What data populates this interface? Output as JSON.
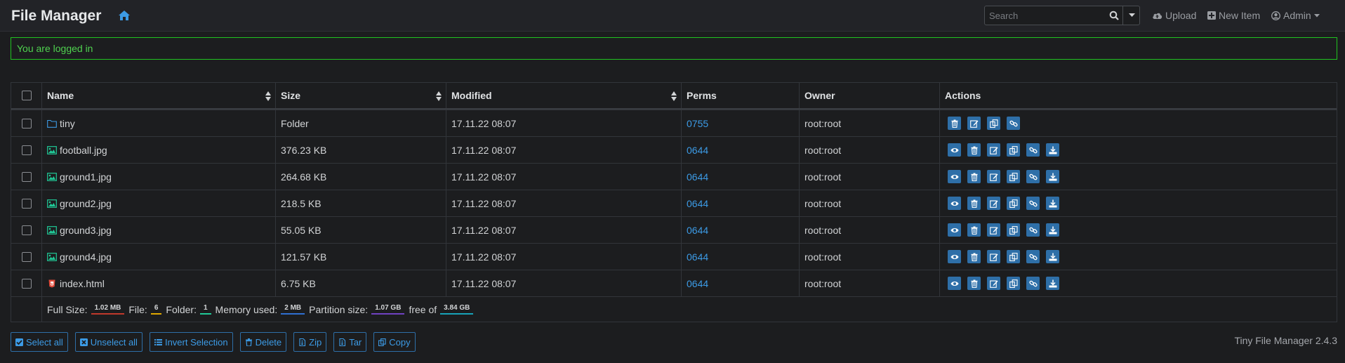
{
  "header": {
    "brand": "File Manager",
    "search_placeholder": "Search",
    "upload_label": "Upload",
    "new_item_label": "New Item",
    "admin_label": "Admin"
  },
  "alert": {
    "message": "You are logged in"
  },
  "table": {
    "columns": [
      "Name",
      "Size",
      "Modified",
      "Perms",
      "Owner",
      "Actions"
    ],
    "rows": [
      {
        "name": "tiny",
        "type": "folder",
        "size": "Folder",
        "modified": "17.11.22 08:07",
        "perms": "0755",
        "owner": "root:root"
      },
      {
        "name": "football.jpg",
        "type": "image",
        "size": "376.23 KB",
        "modified": "17.11.22 08:07",
        "perms": "0644",
        "owner": "root:root"
      },
      {
        "name": "ground1.jpg",
        "type": "image",
        "size": "264.68 KB",
        "modified": "17.11.22 08:07",
        "perms": "0644",
        "owner": "root:root"
      },
      {
        "name": "ground2.jpg",
        "type": "image",
        "size": "218.5 KB",
        "modified": "17.11.22 08:07",
        "perms": "0644",
        "owner": "root:root"
      },
      {
        "name": "ground3.jpg",
        "type": "image",
        "size": "55.05 KB",
        "modified": "17.11.22 08:07",
        "perms": "0644",
        "owner": "root:root"
      },
      {
        "name": "ground4.jpg",
        "type": "image",
        "size": "121.57 KB",
        "modified": "17.11.22 08:07",
        "perms": "0644",
        "owner": "root:root"
      },
      {
        "name": "index.html",
        "type": "html",
        "size": "6.75 KB",
        "modified": "17.11.22 08:07",
        "perms": "0644",
        "owner": "root:root"
      }
    ]
  },
  "footer_stats": {
    "full_size_label": "Full Size:",
    "full_size": "1.02 MB",
    "file_label": "File:",
    "file_count": "6",
    "folder_label": "Folder:",
    "folder_count": "1",
    "memory_label": "Memory used:",
    "memory": "2 MB",
    "partition_label": "Partition size:",
    "partition": "1.07 GB",
    "free_label": "free of",
    "total": "3.84 GB"
  },
  "buttons": {
    "select_all": "Select all",
    "unselect_all": "Unselect all",
    "invert": "Invert Selection",
    "delete": "Delete",
    "zip": "Zip",
    "tar": "Tar",
    "copy": "Copy"
  },
  "version": "Tiny File Manager 2.4.3",
  "colors": {
    "accent": "#3c9be6",
    "action_button": "#2e6fa8",
    "alert_border": "#20c320",
    "badge_size": "#c0392b",
    "badge_file": "#e0a800",
    "badge_folder": "#20c997",
    "badge_memory": "#2f6fd1",
    "badge_partition": "#6f42c1",
    "badge_total": "#17a2b8"
  }
}
